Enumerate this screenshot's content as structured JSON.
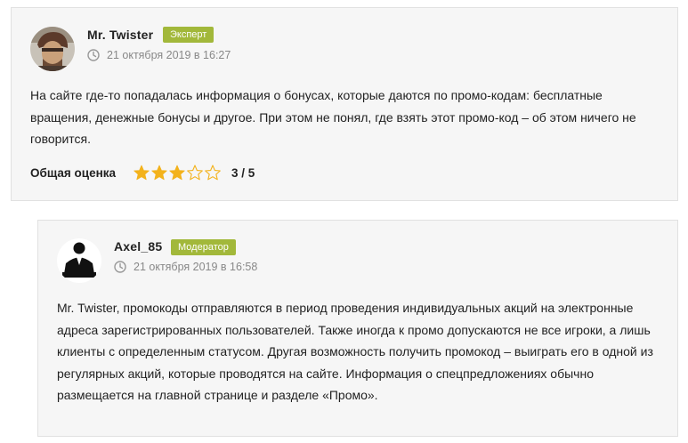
{
  "comments": [
    {
      "author": "Mr. Twister",
      "badge": "Эксперт",
      "date": "21 октября 2019 в 16:27",
      "text": "На сайте где-то попадалась информация о бонусах, которые даются по промо-кодам: бесплатные вращения, денежные бонусы и другое. При этом не понял, где взять этот промо-код – об этом ничего не говорится.",
      "rating": {
        "label": "Общая оценка",
        "value": 3,
        "max": 5,
        "score_text": "3 / 5"
      }
    },
    {
      "author": "Axel_85",
      "badge": "Модератор",
      "date": "21 октября 2019 в 16:58",
      "text": "Mr. Twister, промокоды отправляются в период проведения индивидуальных акций на электронные адреса зарегистрированных пользователей. Также иногда к промо допускаются не все игроки, а лишь клиенты с определенным статусом. Другая возможность получить промокод – выиграть его в одной из регулярных акций, которые проводятся на сайте. Информация о спецпредложениях обычно размещается на главной странице и разделе «Промо»."
    }
  ],
  "colors": {
    "badge": "#a2b83a",
    "star": "#f3b21b",
    "card_bg": "#f6f6f6"
  },
  "icons": {
    "time": "clock-icon",
    "star_full": "star-filled-icon",
    "star_empty": "star-empty-icon"
  }
}
